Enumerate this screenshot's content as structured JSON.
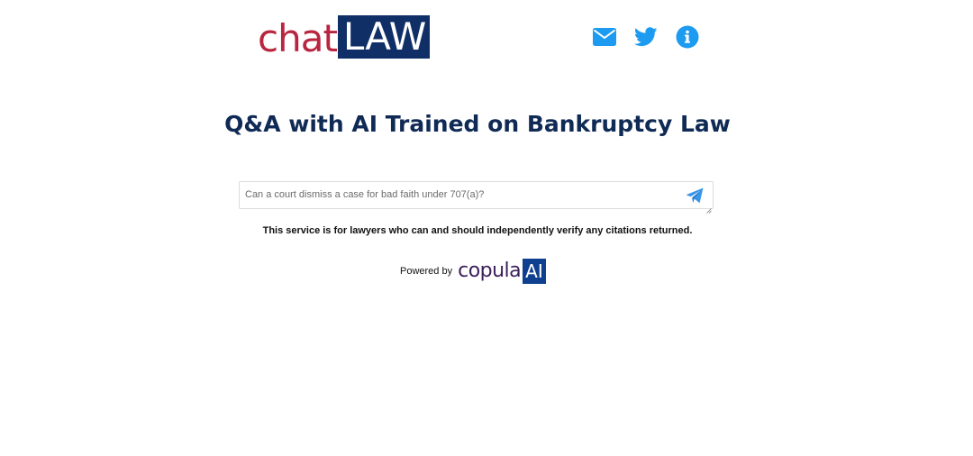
{
  "header": {
    "logo_part1": "chat",
    "logo_part2": "LAW",
    "icons": [
      "mail-icon",
      "twitter-icon",
      "info-icon"
    ]
  },
  "main": {
    "title": "Q&A with AI Trained on Bankruptcy Law",
    "query_placeholder": "Can a court dismiss a case for bad faith under 707(a)?",
    "disclaimer": "This service is for lawyers who can and should independently verify any citations returned."
  },
  "footer": {
    "powered_label": "Powered by",
    "brand_part1": "copula",
    "brand_part2": "AI"
  },
  "colors": {
    "logo_red": "#b8253f",
    "logo_navy": "#0f2f66",
    "icon_blue": "#1d9bf0",
    "title_navy": "#0f2a55",
    "brand_purple": "#3b1f5c",
    "brand_blue": "#0f3f8f"
  }
}
